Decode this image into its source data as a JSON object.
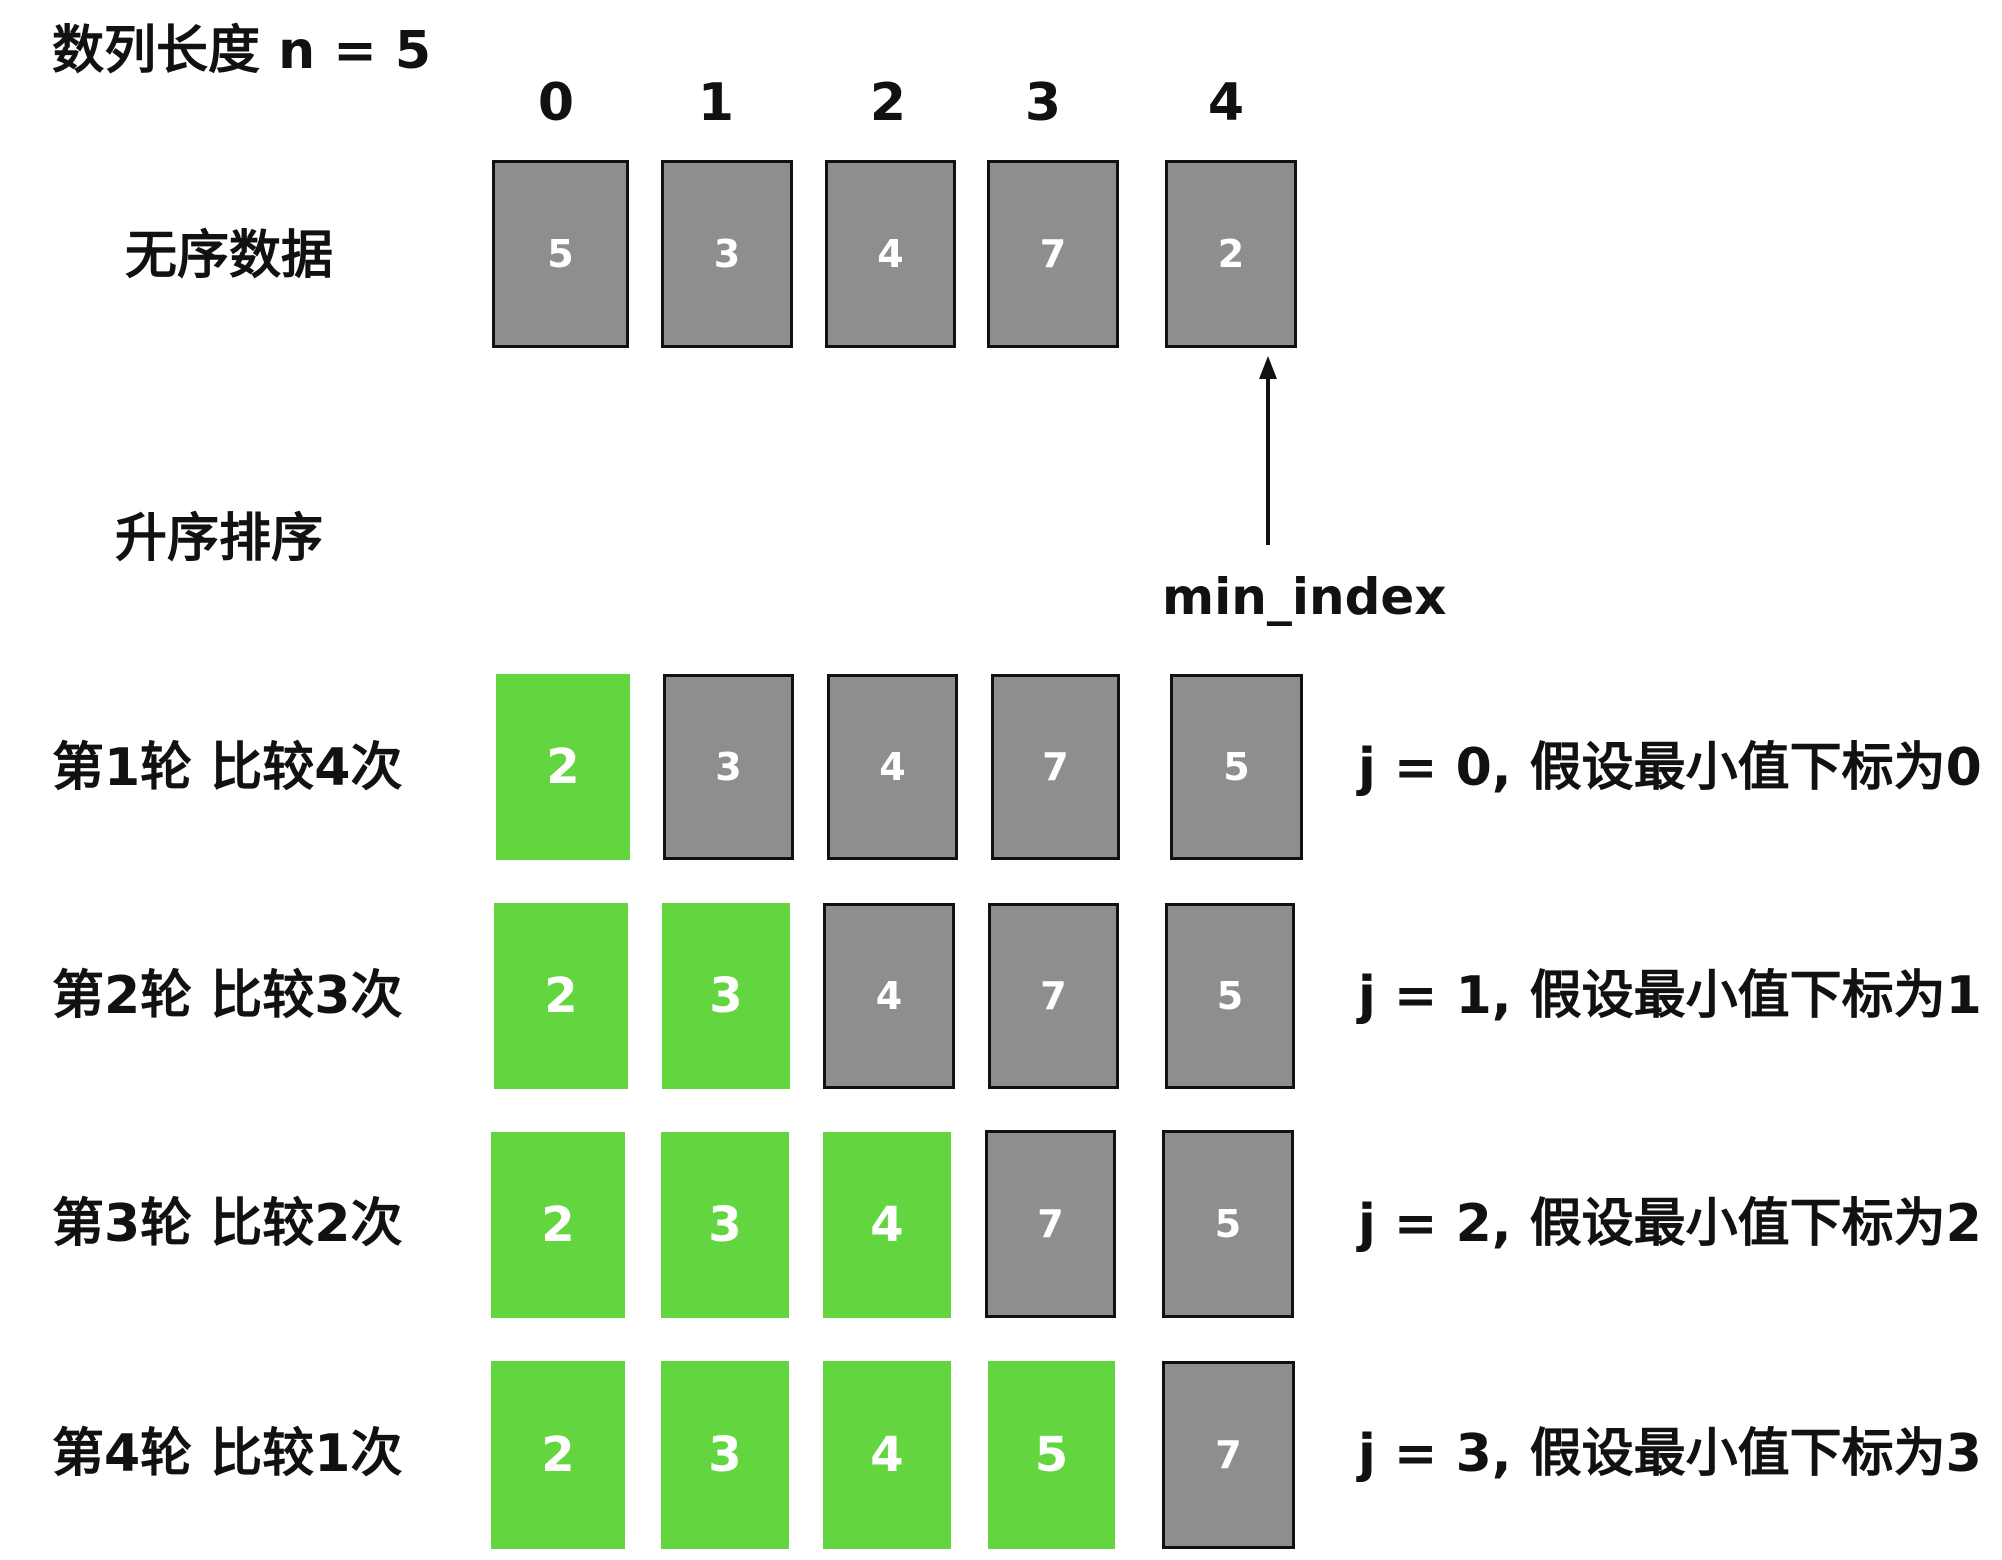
{
  "title": "数列长度 n = 5",
  "indices": [
    "0",
    "1",
    "2",
    "3",
    "4"
  ],
  "unsorted": {
    "label": "无序数据",
    "values": [
      "5",
      "3",
      "4",
      "7",
      "2"
    ]
  },
  "sort_label": "升序排序",
  "pointer_label": "min_index",
  "rounds": [
    {
      "label": "第1轮 比较4次",
      "values": [
        "2",
        "3",
        "4",
        "7",
        "5"
      ],
      "sorted_count": 1,
      "note": "j = 0, 假设最小值下标为0"
    },
    {
      "label": "第2轮 比较3次",
      "values": [
        "2",
        "3",
        "4",
        "7",
        "5"
      ],
      "sorted_count": 2,
      "note": "j = 1, 假设最小值下标为1"
    },
    {
      "label": "第3轮 比较2次",
      "values": [
        "2",
        "3",
        "4",
        "7",
        "5"
      ],
      "sorted_count": 3,
      "note": "j = 2, 假设最小值下标为2"
    },
    {
      "label": "第4轮 比较1次",
      "values": [
        "2",
        "3",
        "4",
        "5",
        "7"
      ],
      "sorted_count": 4,
      "note": "j = 3, 假设最小值下标为3"
    }
  ],
  "colors": {
    "unsorted_box": "#8e8e8e",
    "sorted_box": "#63d53f",
    "border": "#111111"
  }
}
